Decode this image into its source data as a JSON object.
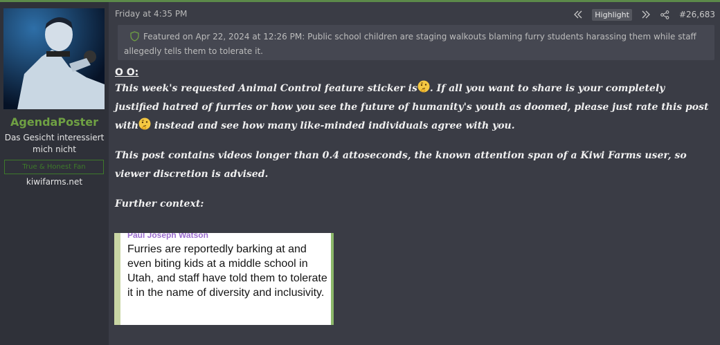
{
  "user": {
    "name": "AgendaPoster",
    "title": "Das Gesicht interessiert mich nicht",
    "banner": "True & Honest Fan",
    "site": "kiwifarms.net"
  },
  "post": {
    "date": "Friday at 4:35 PM",
    "highlight_label": "Highlight",
    "number": "#26,683",
    "featured_text": "Featured on Apr 22, 2024 at 12:26 PM: Public school children are staging walkouts blaming furry students harassing them while staff allegedly tells them to tolerate it.",
    "heading": "O O:",
    "para1_a": "This week's requested Animal Control feature sticker is",
    "para1_b": ". If all you want to share is your completely justified hatred of furries or how you see the future of humanity's youth as doomed, please just rate this post with",
    "para1_c": " instead and see how many like-minded individuals agree with you.",
    "para2": "This post contains videos longer than 0.4 attoseconds, the known attention span of a Kiwi Farms user, so viewer discretion is advised.",
    "para3": "Further context:",
    "embed": {
      "author": "Paul Joseph Watson",
      "text": "Furries are reportedly barking at and even biting kids at a middle school in Utah, and staff have told them to tolerate it in the name of diversity and inclusivity."
    }
  },
  "icons": {
    "prev": "rewind-icon",
    "next": "fast-forward-icon",
    "share": "share-icon",
    "featured": "shield-icon",
    "sticker": "thinking-face-emoji"
  },
  "colors": {
    "username": "#6fa043",
    "banner": "#3e7a2a",
    "embed_author": "#9b6dcf"
  }
}
